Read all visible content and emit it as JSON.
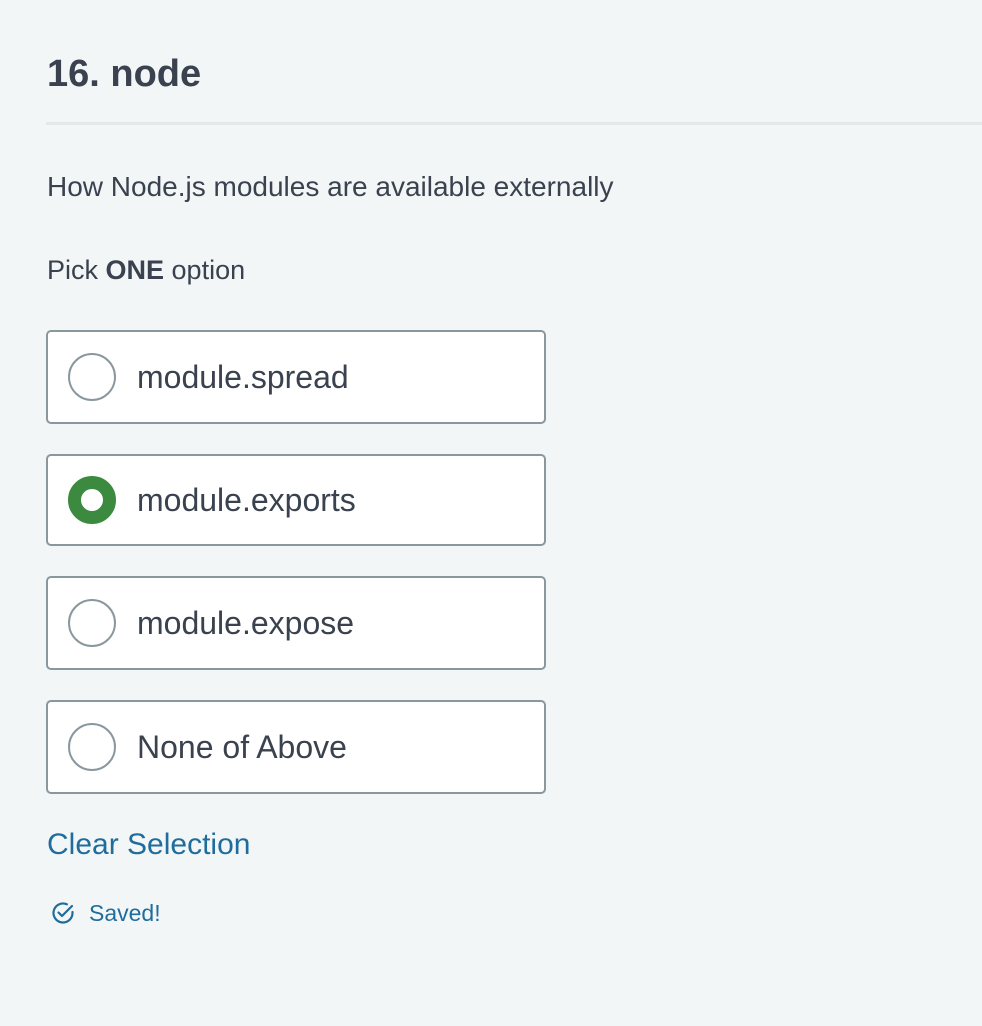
{
  "question": {
    "title": "16. node",
    "text": "How Node.js modules are available externally"
  },
  "instruction": {
    "prefix": "Pick ",
    "emphasis": "ONE",
    "suffix": " option"
  },
  "options": [
    {
      "label": "module.spread",
      "selected": false
    },
    {
      "label": "module.exports",
      "selected": true
    },
    {
      "label": "module.expose",
      "selected": false
    },
    {
      "label": "None of Above",
      "selected": false
    }
  ],
  "clear_selection_label": "Clear Selection",
  "status": {
    "icon": "check-circle-icon",
    "text": "Saved!"
  },
  "colors": {
    "background": "#f3f6f7",
    "text": "#39424e",
    "selected": "#3c8a3f",
    "link": "#1f6d9c"
  }
}
